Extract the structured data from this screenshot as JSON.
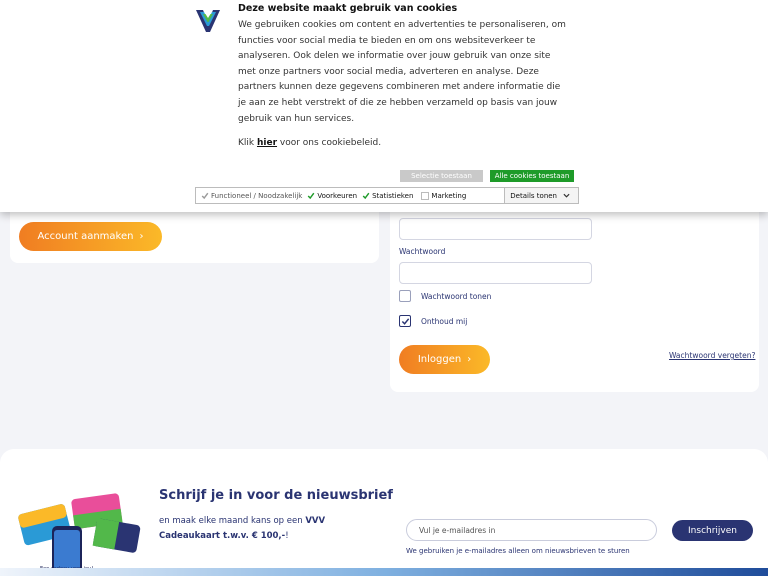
{
  "cookie": {
    "title": "Deze website maakt gebruik van cookies",
    "body": "We gebruiken cookies om content en advertenties te personaliseren, om functies voor social media te bieden en om ons websiteverkeer te analyseren. Ook delen we informatie over jouw gebruik van onze site met onze partners voor social media, adverteren en analyse. Deze partners kunnen deze gegevens combineren met andere informatie die je aan ze hebt verstrekt of die ze hebben verzameld op basis van jouw gebruik van hun services.",
    "link_prefix": "Klik ",
    "link_text": "hier",
    "link_suffix": " voor ons cookiebeleid.",
    "btn_selection": "Selectie toestaan",
    "btn_all": "Alle cookies toestaan",
    "options": [
      {
        "label": "Functioneel / Noodzakelijk",
        "checked": true,
        "disabled": true
      },
      {
        "label": "Voorkeuren",
        "checked": true
      },
      {
        "label": "Statistieken",
        "checked": true
      },
      {
        "label": "Marketing",
        "checked": false
      }
    ],
    "details_label": "Details tonen"
  },
  "left": {
    "account_btn": "Account aanmaken"
  },
  "login": {
    "password_label": "Wachtwoord",
    "show_password": "Wachtwoord tonen",
    "remember_me": "Onthoud mij",
    "remember_checked": true,
    "login_btn": "Inloggen",
    "forgot": "Wachtwoord vergeten?"
  },
  "newsletter": {
    "title": "Schrijf je in voor de nieuwsbrief",
    "text_prefix": "en maak elke maand kans op een ",
    "text_bold": "VVV Cadeaukaart t.w.v. € 100,-",
    "text_suffix": "!",
    "email_placeholder": "Vul je e-mailadres in",
    "subscribe_btn": "Inschrijven",
    "note": "We gebruiken je e-mailadres alleen om nieuwsbrieven te sturen",
    "card_caption": "Een cadeau voor jou!"
  },
  "colors": {
    "navy": "#2a3472",
    "orange_start": "#f07d22",
    "orange_end": "#fbb928",
    "green": "#1e9b29"
  }
}
